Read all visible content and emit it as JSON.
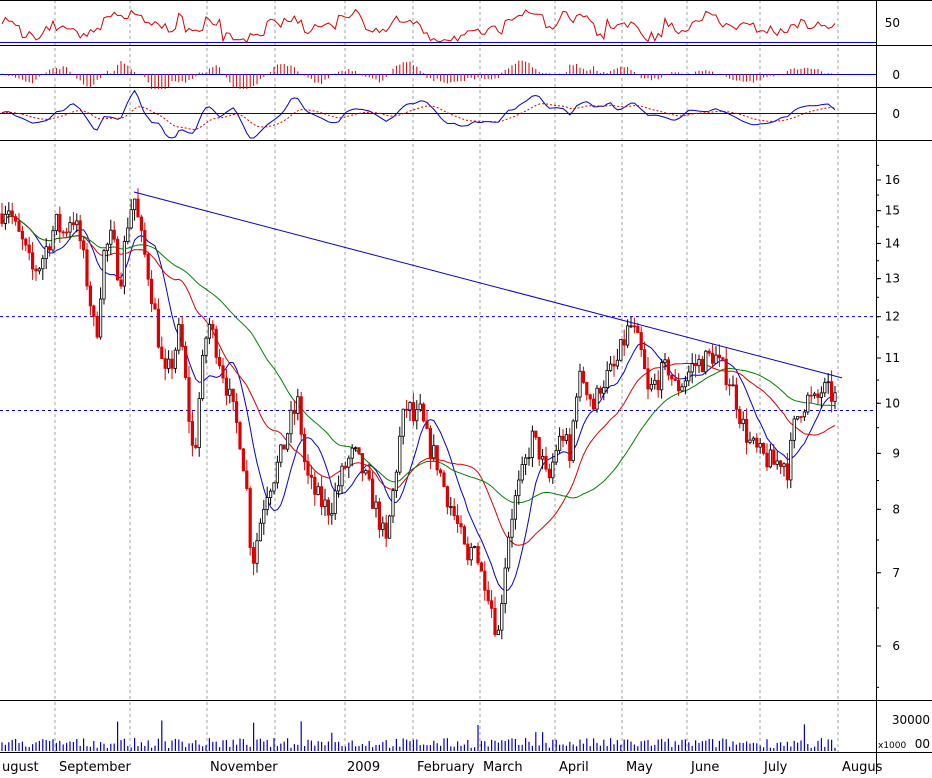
{
  "chart_data": {
    "type": "candlestick",
    "title": "",
    "price_axis": {
      "scale": "log",
      "ylim": [
        5.2,
        17
      ],
      "ticks": [
        6,
        7,
        8,
        9,
        10,
        11,
        12,
        13,
        14,
        15,
        16
      ]
    },
    "x_labels": [
      "ugust",
      "September",
      "November",
      "2009",
      "February",
      "March",
      "April",
      "May",
      "June",
      "July",
      "Augus"
    ],
    "horizontal_levels": [
      12,
      9.85
    ],
    "trendline": {
      "from_price": 15.6,
      "to_price": 10.55
    },
    "price_path": [
      [
        0,
        14.9
      ],
      [
        8,
        15.2
      ],
      [
        16,
        14.4
      ],
      [
        24,
        13.9
      ],
      [
        32,
        13.2
      ],
      [
        40,
        13.4
      ],
      [
        48,
        14.0
      ],
      [
        56,
        14.6
      ],
      [
        64,
        14.3
      ],
      [
        72,
        14.9
      ],
      [
        80,
        14.1
      ],
      [
        88,
        12.8
      ],
      [
        96,
        11.4
      ],
      [
        104,
        13.7
      ],
      [
        112,
        14.2
      ],
      [
        120,
        12.9
      ],
      [
        128,
        14.7
      ],
      [
        134,
        15.5
      ],
      [
        140,
        14.3
      ],
      [
        148,
        13.2
      ],
      [
        156,
        11.9
      ],
      [
        164,
        10.5
      ],
      [
        172,
        10.9
      ],
      [
        180,
        11.7
      ],
      [
        188,
        9.9
      ],
      [
        194,
        8.8
      ],
      [
        200,
        10.3
      ],
      [
        208,
        11.9
      ],
      [
        216,
        11.3
      ],
      [
        224,
        10.6
      ],
      [
        232,
        9.9
      ],
      [
        240,
        9.3
      ],
      [
        246,
        8.5
      ],
      [
        252,
        7.1
      ],
      [
        258,
        7.6
      ],
      [
        266,
        8.3
      ],
      [
        274,
        8.6
      ],
      [
        282,
        9.0
      ],
      [
        290,
        9.6
      ],
      [
        298,
        10.0
      ],
      [
        306,
        8.6
      ],
      [
        314,
        8.3
      ],
      [
        322,
        8.1
      ],
      [
        330,
        8.0
      ],
      [
        338,
        8.4
      ],
      [
        346,
        8.8
      ],
      [
        354,
        9.0
      ],
      [
        362,
        8.7
      ],
      [
        370,
        8.3
      ],
      [
        378,
        7.9
      ],
      [
        386,
        7.4
      ],
      [
        394,
        8.4
      ],
      [
        402,
        9.6
      ],
      [
        408,
        10.0
      ],
      [
        414,
        9.6
      ],
      [
        420,
        9.8
      ],
      [
        428,
        9.2
      ],
      [
        436,
        8.9
      ],
      [
        444,
        8.4
      ],
      [
        452,
        8.0
      ],
      [
        460,
        7.6
      ],
      [
        468,
        7.1
      ],
      [
        474,
        7.6
      ],
      [
        480,
        7.0
      ],
      [
        486,
        6.9
      ],
      [
        492,
        6.5
      ],
      [
        498,
        6.1
      ],
      [
        504,
        7.0
      ],
      [
        510,
        7.8
      ],
      [
        516,
        8.2
      ],
      [
        524,
        8.7
      ],
      [
        532,
        9.3
      ],
      [
        540,
        9.0
      ],
      [
        548,
        8.4
      ],
      [
        556,
        9.1
      ],
      [
        564,
        9.4
      ],
      [
        570,
        8.8
      ],
      [
        576,
        10.3
      ],
      [
        582,
        10.6
      ],
      [
        588,
        10.3
      ],
      [
        594,
        9.9
      ],
      [
        600,
        10.4
      ],
      [
        608,
        10.6
      ],
      [
        616,
        10.8
      ],
      [
        624,
        11.4
      ],
      [
        630,
        11.8
      ],
      [
        636,
        11.5
      ],
      [
        642,
        11.0
      ],
      [
        648,
        10.2
      ],
      [
        654,
        10.4
      ],
      [
        660,
        10.6
      ],
      [
        668,
        10.8
      ],
      [
        676,
        10.3
      ],
      [
        684,
        10.5
      ],
      [
        692,
        10.8
      ],
      [
        700,
        10.9
      ],
      [
        708,
        11.0
      ],
      [
        714,
        11.1
      ],
      [
        720,
        10.8
      ],
      [
        728,
        10.6
      ],
      [
        736,
        10.1
      ],
      [
        742,
        9.6
      ],
      [
        750,
        9.2
      ],
      [
        758,
        9.0
      ],
      [
        766,
        8.9
      ],
      [
        774,
        8.8
      ],
      [
        782,
        8.9
      ],
      [
        788,
        8.7
      ],
      [
        794,
        9.5
      ],
      [
        800,
        9.9
      ],
      [
        808,
        10.1
      ],
      [
        816,
        10.0
      ],
      [
        822,
        10.3
      ],
      [
        830,
        10.2
      ],
      [
        836,
        10.1
      ]
    ],
    "moving_averages": [
      {
        "color": "#0000cc",
        "period": 10
      },
      {
        "color": "#dd0000",
        "period": 24
      },
      {
        "color": "#008000",
        "period": 45
      }
    ],
    "oscillator_panels": [
      {
        "label": "50",
        "type": "line",
        "color": "#dd0000"
      },
      {
        "label": "0",
        "type": "histogram",
        "color": "#dd0000"
      },
      {
        "label": "0",
        "type": "macd",
        "colors": [
          "#0000cc",
          "#dd0000"
        ]
      }
    ],
    "volume": {
      "label": "30000",
      "unit_label": "x1000",
      "baseline_label": "00"
    }
  }
}
